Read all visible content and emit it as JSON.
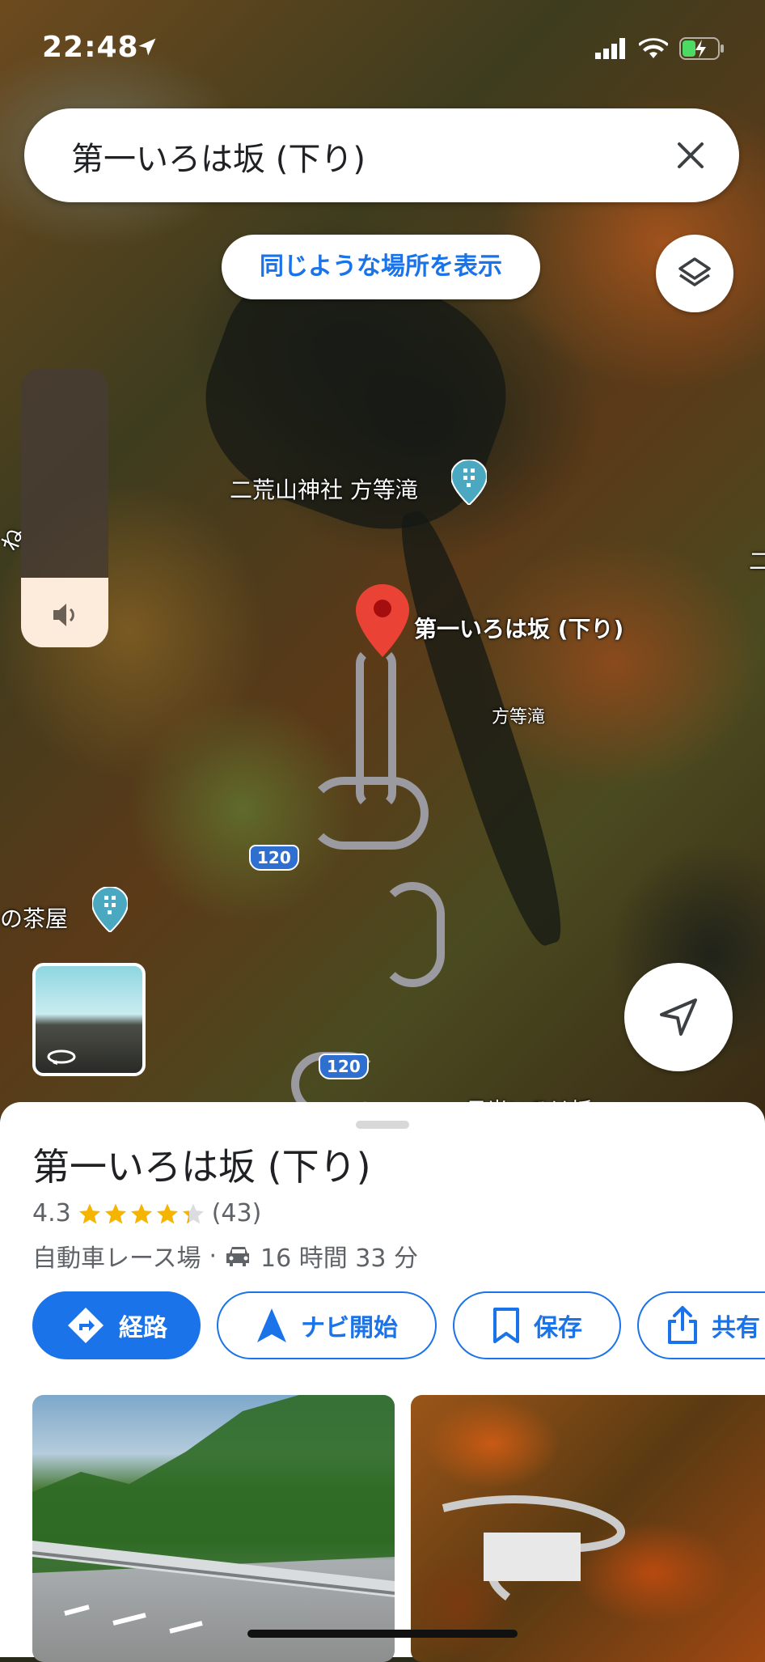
{
  "status_bar": {
    "time": "22:48"
  },
  "search": {
    "query": "第一いろは坂 (下り)"
  },
  "map": {
    "similar_places_label": "同じような場所を表示",
    "labels": {
      "shrine": "二荒山神社 方等滝",
      "selected_place": "第一いろは坂 (下り)",
      "waterfall": "方等滝",
      "teahouse": "の茶屋",
      "left_edge": "ね",
      "right_edge": "二",
      "route_shield_1": "120",
      "route_shield_2": "120",
      "bottom_partial": "日光いろは坂"
    },
    "volume_level": 0.25
  },
  "place": {
    "title": "第一いろは坂 (下り)",
    "rating": "4.3",
    "rating_value": 4.3,
    "review_count": "(43)",
    "category": "自動車レース場",
    "separator": "·",
    "drive_time": "16 時間 33 分"
  },
  "actions": {
    "directions": "経路",
    "navigate": "ナビ開始",
    "save": "保存",
    "share": "共有"
  },
  "colors": {
    "accent": "#1a73e8",
    "star": "#f5b400",
    "pin_red": "#ea4335",
    "pin_teal": "#4aa8c0"
  }
}
